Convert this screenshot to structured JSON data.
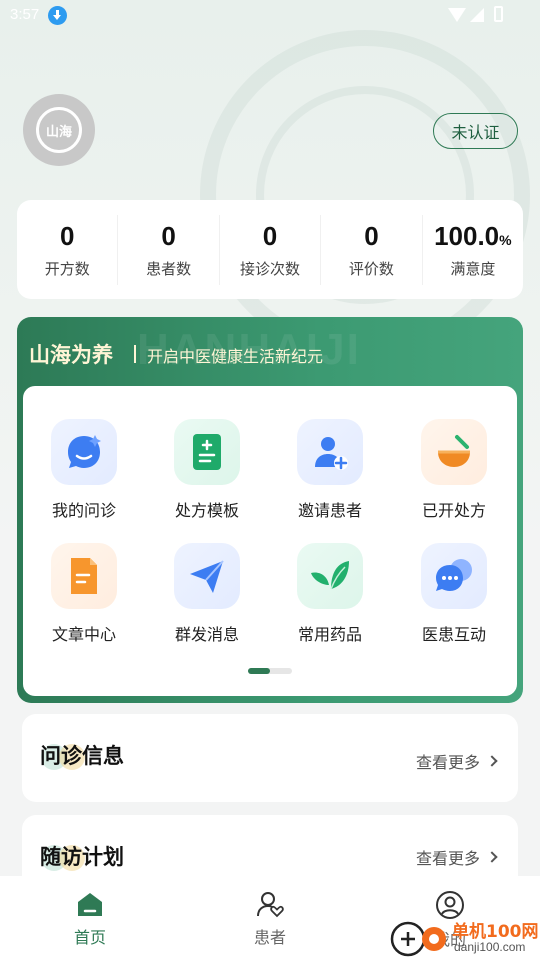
{
  "status_bar": {
    "time": "3:57"
  },
  "profile": {
    "cert_label": "未认证",
    "avatar_text": "山海"
  },
  "stats": [
    {
      "value": "0",
      "unit": "",
      "label": "开方数"
    },
    {
      "value": "0",
      "unit": "",
      "label": "患者数"
    },
    {
      "value": "0",
      "unit": "",
      "label": "接诊次数"
    },
    {
      "value": "0",
      "unit": "",
      "label": "评价数"
    },
    {
      "value": "100.0",
      "unit": "%",
      "label": "满意度"
    }
  ],
  "banner": {
    "title": "山海为养",
    "subtitle": "开启中医健康生活新纪元",
    "bg_text": "HANHAIJI"
  },
  "menu": [
    {
      "label": "我的问诊",
      "icon": "consult-icon"
    },
    {
      "label": "处方模板",
      "icon": "prescription-template-icon"
    },
    {
      "label": "邀请患者",
      "icon": "invite-patient-icon"
    },
    {
      "label": "已开处方",
      "icon": "mortar-icon"
    },
    {
      "label": "文章中心",
      "icon": "article-icon"
    },
    {
      "label": "群发消息",
      "icon": "send-icon"
    },
    {
      "label": "常用药品",
      "icon": "leaf-icon"
    },
    {
      "label": "医患互动",
      "icon": "chat-icon"
    }
  ],
  "sections": [
    {
      "title": "问诊信息",
      "more": "查看更多"
    },
    {
      "title": "随访计划",
      "more": "查看更多"
    }
  ],
  "tabs": [
    {
      "label": "首页",
      "active": true
    },
    {
      "label": "患者",
      "active": false
    },
    {
      "label": "我的",
      "active": false
    }
  ],
  "watermark": {
    "text": "单机100网",
    "url": "danji100.com"
  },
  "colors": {
    "primary": "#2f7a55",
    "banner_gold": "#fff5d6"
  }
}
